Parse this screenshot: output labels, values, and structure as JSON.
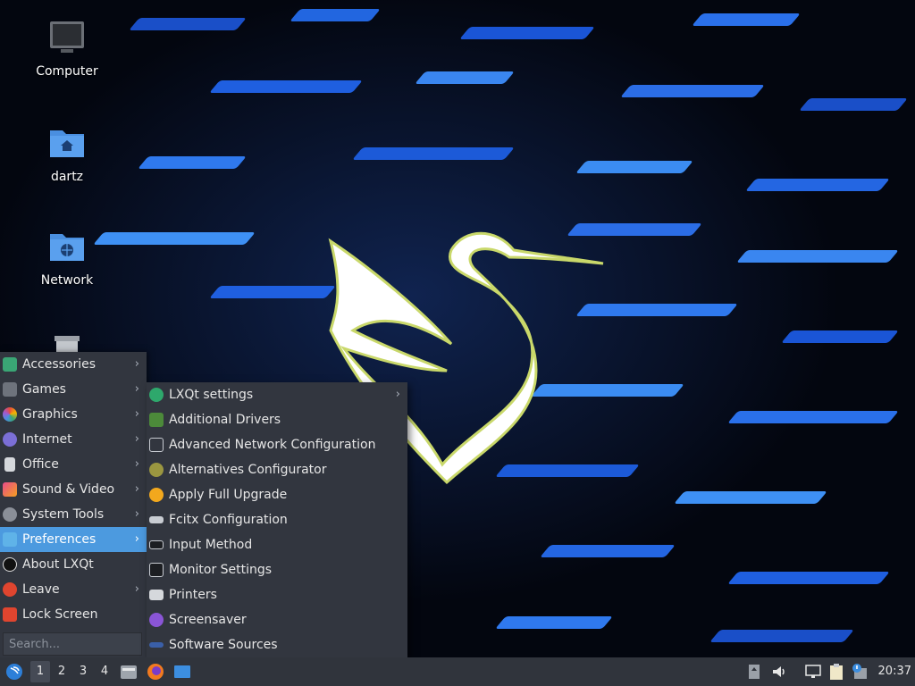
{
  "desktop": {
    "icons": [
      {
        "label": "Computer"
      },
      {
        "label": "dartz"
      },
      {
        "label": "Network"
      }
    ]
  },
  "main_menu": {
    "items": [
      {
        "label": "Accessories",
        "submenu": true
      },
      {
        "label": "Games",
        "submenu": true
      },
      {
        "label": "Graphics",
        "submenu": true
      },
      {
        "label": "Internet",
        "submenu": true
      },
      {
        "label": "Office",
        "submenu": true
      },
      {
        "label": "Sound & Video",
        "submenu": true
      },
      {
        "label": "System Tools",
        "submenu": true
      },
      {
        "label": "Preferences",
        "submenu": true,
        "active": true
      },
      {
        "label": "About LXQt",
        "submenu": false
      },
      {
        "label": "Leave",
        "submenu": true
      },
      {
        "label": "Lock Screen",
        "submenu": false
      }
    ],
    "search_placeholder": "Search..."
  },
  "preferences_menu": {
    "items": [
      {
        "label": "LXQt settings",
        "submenu": true
      },
      {
        "label": "Additional Drivers"
      },
      {
        "label": "Advanced Network Configuration"
      },
      {
        "label": "Alternatives Configurator"
      },
      {
        "label": "Apply Full Upgrade"
      },
      {
        "label": "Fcitx Configuration"
      },
      {
        "label": "Input Method"
      },
      {
        "label": "Monitor Settings"
      },
      {
        "label": "Printers"
      },
      {
        "label": "Screensaver"
      },
      {
        "label": "Software Sources"
      }
    ]
  },
  "taskbar": {
    "desktops": [
      "1",
      "2",
      "3",
      "4"
    ],
    "current_desktop": "1",
    "clock": "20:37"
  },
  "colors": {
    "menu_bg": "#32363f",
    "highlight": "#4c9adf",
    "taskbar_bg": "#30343c",
    "folder_blue": "#4a8fe0"
  },
  "arrow_glyph": "›"
}
